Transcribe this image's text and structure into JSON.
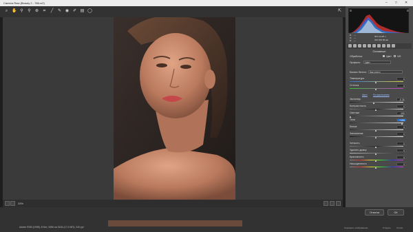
{
  "window": {
    "title": "Camera Raw (Beauty 2 - 786.cr2)",
    "controls": {
      "minimize": "–",
      "maximize": "□",
      "close": "✕"
    }
  },
  "toolbar": {
    "tools": [
      "zoom-icon",
      "hand-icon",
      "white-balance-icon",
      "color-sampler-icon",
      "targeted-adjust-icon",
      "crop-icon",
      "straighten-icon",
      "spot-removal-icon",
      "red-eye-icon",
      "adjustment-brush-icon",
      "graduated-filter-icon",
      "radial-filter-icon"
    ],
    "fullscreen": "⇱"
  },
  "canvas": {
    "zoom": "33%"
  },
  "readout": {
    "r_label": "R:",
    "g_label": "G:",
    "b_label": "B:",
    "r_value": "---",
    "g_value": "---",
    "b_value": "---",
    "info1": "f/5.6   1/125 с",
    "info2": "ISO 200   85 мм"
  },
  "panel": {
    "section_title": "Основные",
    "treatment_label": "Обработка:",
    "treatment_color": "Цвет",
    "treatment_bw": "Ч/Б",
    "profile_label": "Профиль:",
    "profile_value": "Цвет",
    "wb_label": "Баланс белого:",
    "wb_value": "Как снято",
    "auto_label": "Авто",
    "default_label": "По умолчанию",
    "sliders": [
      {
        "label": "Температура",
        "value": "0"
      },
      {
        "label": "Оттенок",
        "value": "0"
      },
      {
        "label": "Экспонир.",
        "value": "-0.30"
      },
      {
        "label": "Контрастность",
        "value": "0"
      },
      {
        "label": "Светлые",
        "value": "-100"
      },
      {
        "label": "Тени",
        "value": "+100"
      },
      {
        "label": "Белые",
        "value": "0"
      },
      {
        "label": "Затемнение",
        "value": "0"
      },
      {
        "label": "Четкость",
        "value": "0"
      },
      {
        "label": "Удалить дымку",
        "value": "0"
      },
      {
        "label": "Красочность",
        "value": "0"
      },
      {
        "label": "Насыщенность",
        "value": "0"
      }
    ]
  },
  "bottom": {
    "workflow_link": "Adobe RGB (1998); 8 бит; 3456 на 5184 (17,9 МП); 240 ppi",
    "open_label": "Открыть",
    "ok_label": "ОК",
    "cancel_label": "Отмена",
    "save_label": "Сохранить изображение...",
    "done_label": "Готово"
  },
  "colors": {
    "highlight_value": "#1f6fd6",
    "panel_bg": "#4a4a4a",
    "canvas_bg": "#3a3a3a"
  }
}
